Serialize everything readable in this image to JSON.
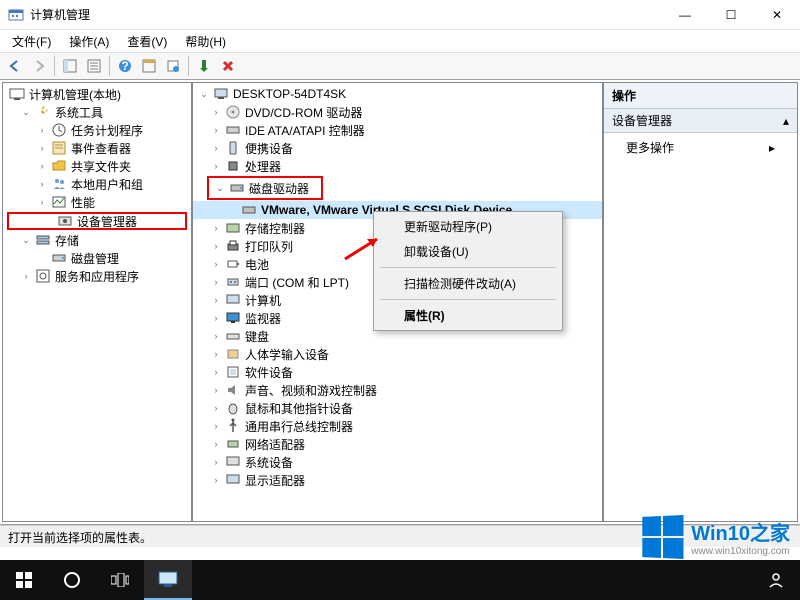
{
  "window": {
    "title": "计算机管理",
    "min": "—",
    "max": "☐",
    "close": "✕"
  },
  "menu": {
    "file": "文件(F)",
    "action": "操作(A)",
    "view": "查看(V)",
    "help": "帮助(H)"
  },
  "left_tree": {
    "root": "计算机管理(本地)",
    "system_tools": "系统工具",
    "task_scheduler": "任务计划程序",
    "event_viewer": "事件查看器",
    "shared_folders": "共享文件夹",
    "local_users": "本地用户和组",
    "performance": "性能",
    "device_manager": "设备管理器",
    "storage": "存储",
    "disk_management": "磁盘管理",
    "services_apps": "服务和应用程序"
  },
  "center_tree": {
    "computer": "DESKTOP-54DT4SK",
    "dvd": "DVD/CD-ROM 驱动器",
    "ide": "IDE ATA/ATAPI 控制器",
    "portable": "便携设备",
    "processor": "处理器",
    "disk_drive": "磁盘驱动器",
    "vmware_disk": "VMware, VMware Virtual S SCSI Disk Device",
    "storage_ctrl": "存储控制器",
    "print_queue": "打印队列",
    "battery": "电池",
    "ports": "端口 (COM 和 LPT)",
    "computers": "计算机",
    "monitor": "监视器",
    "keyboard": "键盘",
    "hid": "人体学输入设备",
    "software_dev": "软件设备",
    "sound": "声音、视频和游戏控制器",
    "mouse": "鼠标和其他指针设备",
    "usb": "通用串行总线控制器",
    "network": "网络适配器",
    "system_dev": "系统设备",
    "display": "显示适配器"
  },
  "context_menu": {
    "update_driver": "更新驱动程序(P)",
    "uninstall": "卸载设备(U)",
    "scan_hw": "扫描检测硬件改动(A)",
    "properties": "属性(R)"
  },
  "actions": {
    "header": "操作",
    "device_manager": "设备管理器",
    "more_actions": "更多操作"
  },
  "statusbar": {
    "text": "打开当前选择项的属性表。"
  },
  "watermark": {
    "line1": "Win10之家",
    "line2": "www.win10xitong.com"
  }
}
